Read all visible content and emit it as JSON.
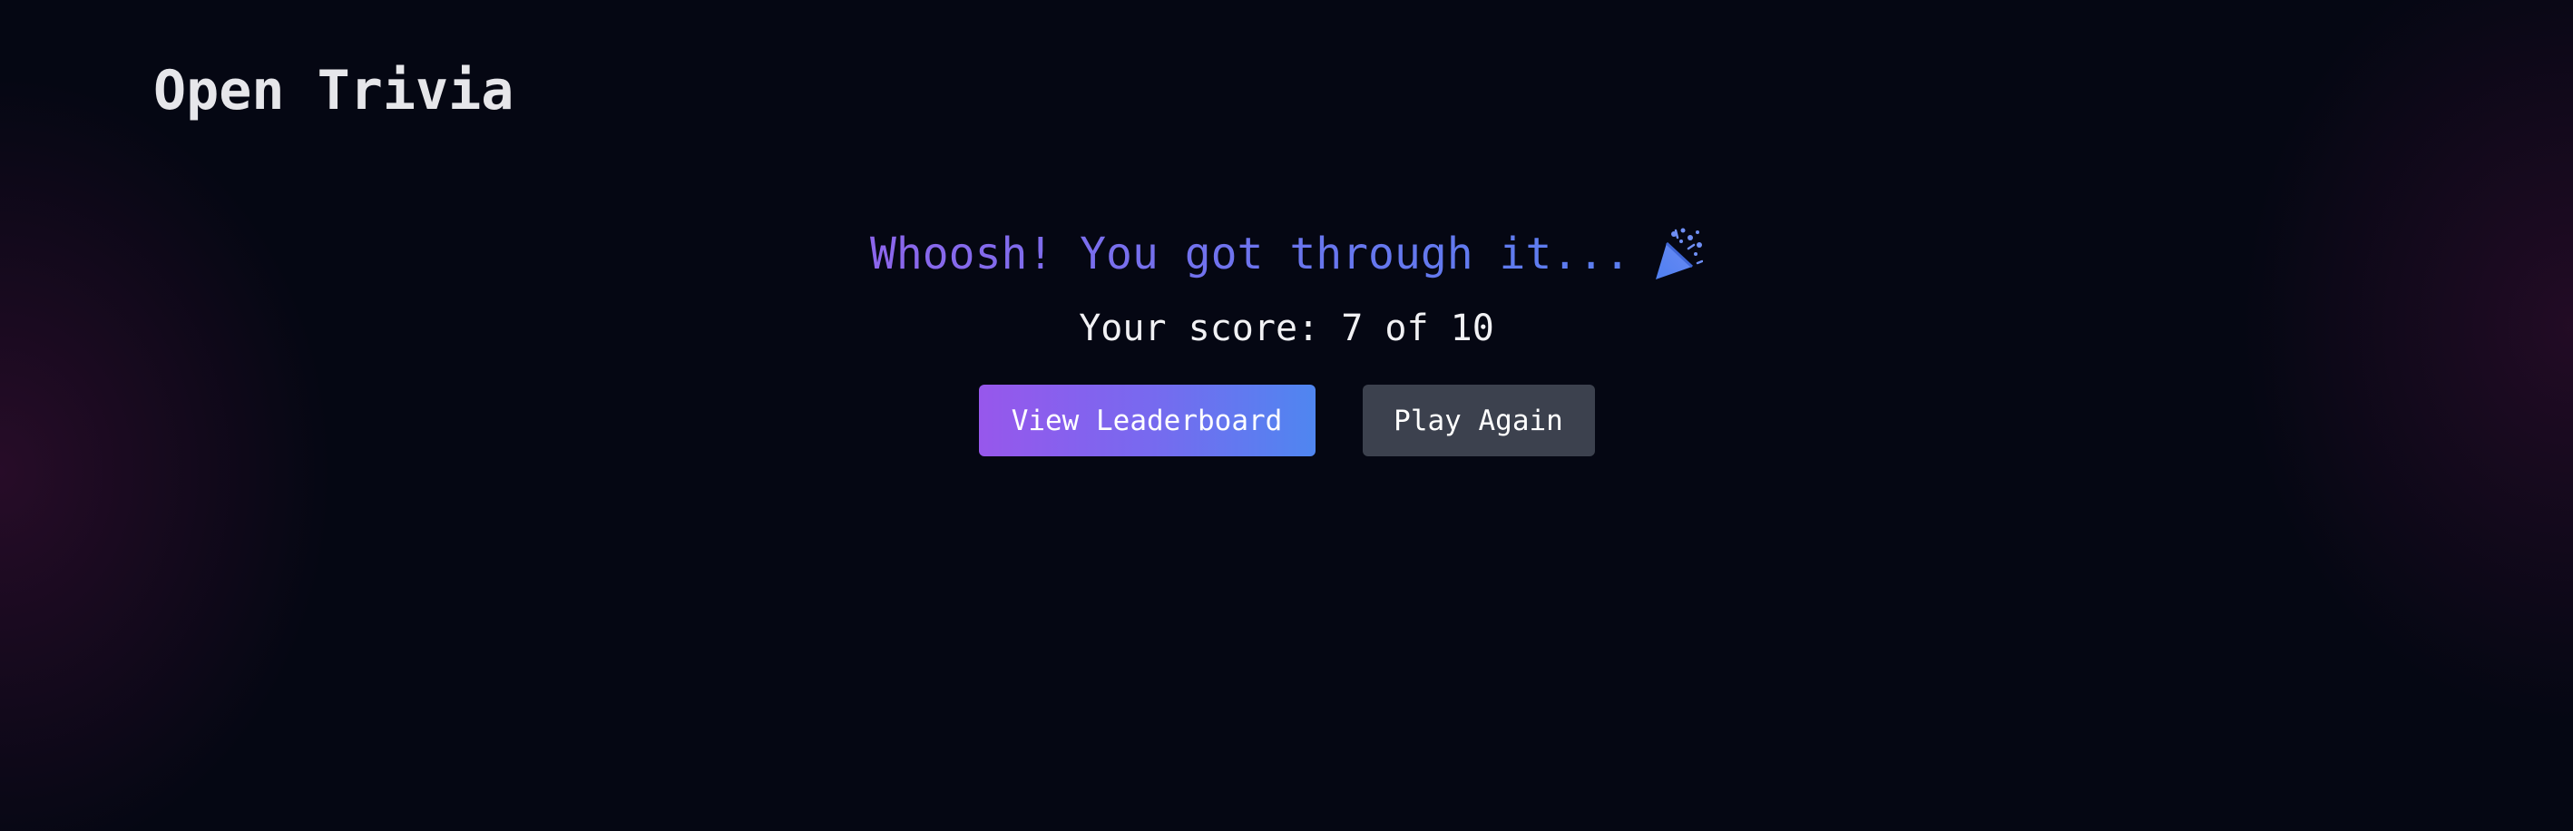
{
  "header": {
    "title": "Open Trivia"
  },
  "results": {
    "headline": "Whoosh! You got through it...",
    "headline_icon": "party-popper-icon",
    "score_text": "Your score: 7 of 10"
  },
  "actions": {
    "leaderboard_label": "View Leaderboard",
    "play_again_label": "Play Again"
  },
  "colors": {
    "background": "#050713",
    "primary_gradient_start": "#9757ec",
    "primary_gradient_end": "#4f86f0",
    "secondary_button": "#3c414e",
    "headline_gradient_start": "#8d66ec",
    "headline_gradient_end": "#5b7ef0"
  }
}
